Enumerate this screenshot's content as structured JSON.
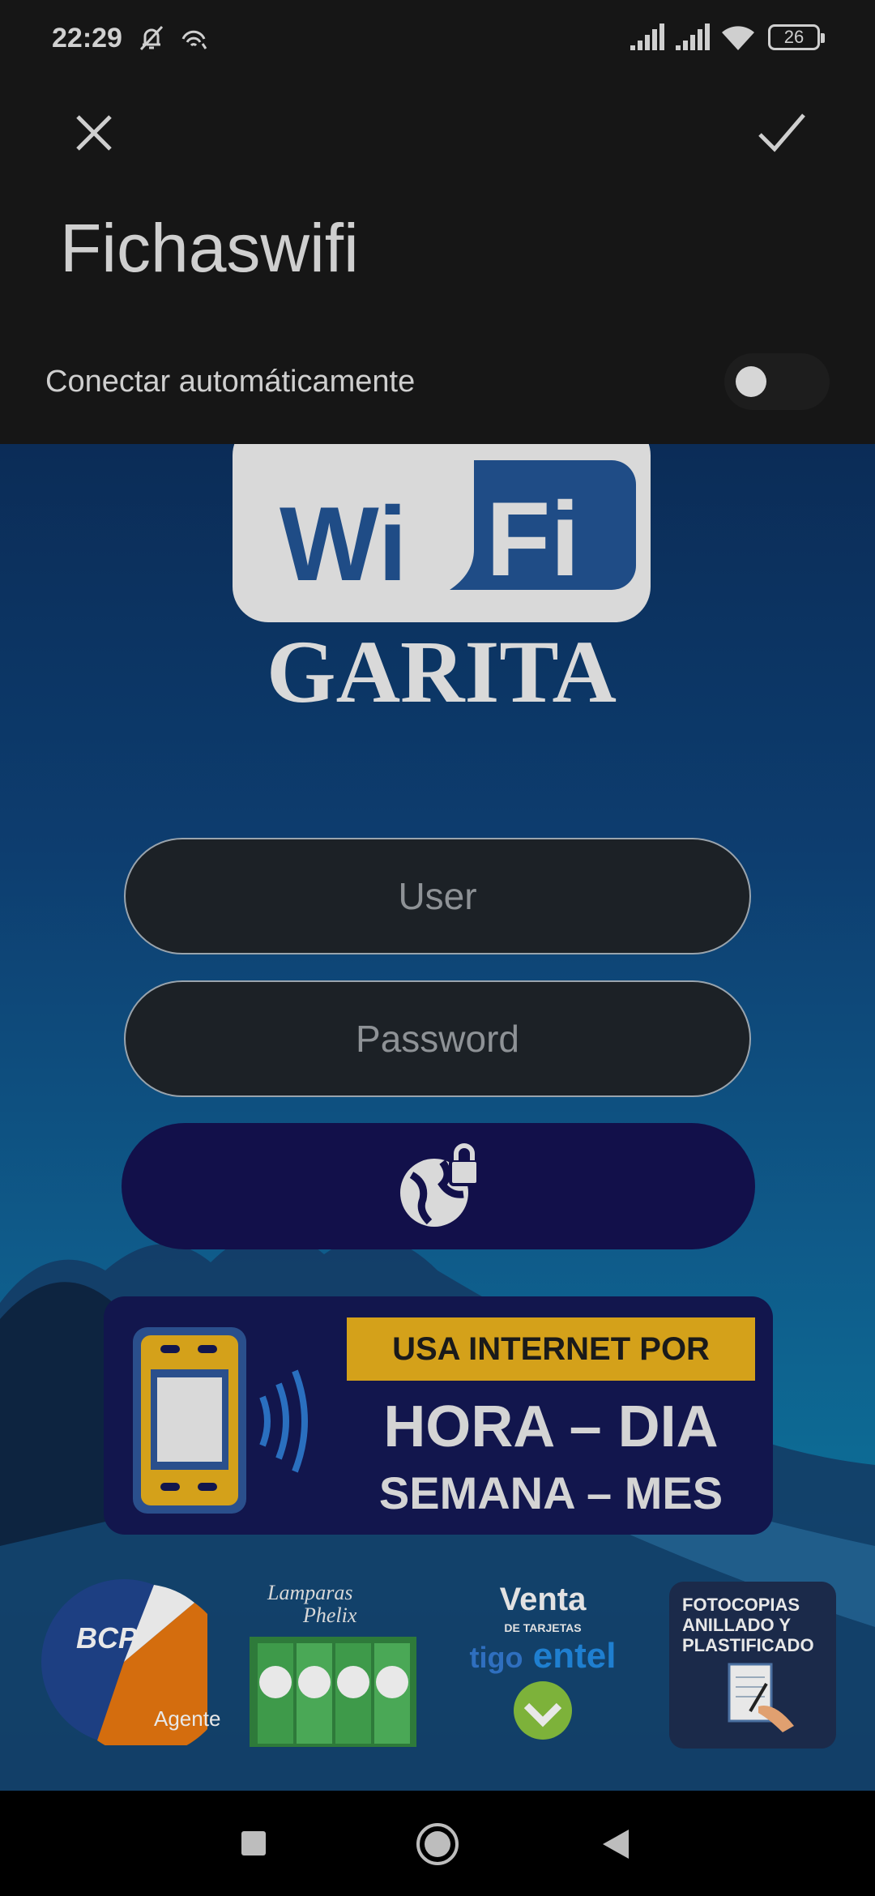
{
  "status_bar": {
    "time": "22:29",
    "battery": "26",
    "icons": [
      "muted-bell-icon",
      "wifi-hotspot-icon",
      "signal-icon",
      "signal-icon",
      "wifi-icon",
      "battery-icon"
    ]
  },
  "dialog": {
    "network_name": "Fichaswifi",
    "auto_connect_label": "Conectar automáticamente",
    "auto_connect_on": false,
    "close_icon": "close-icon",
    "confirm_icon": "check-icon"
  },
  "portal": {
    "logo_text_top": "Wi",
    "logo_text_fi": "Fi",
    "logo_text_bottom": "GARITA",
    "user_placeholder": "User",
    "password_placeholder": "Password",
    "login_icon": "globe-lock-icon",
    "banner": {
      "line1": "USA INTERNET POR",
      "line2": "HORA – DIA",
      "line3": "SEMANA – MES"
    },
    "ads": {
      "bcp_name": "BCP",
      "bcp_sub": "Agente",
      "lamp_title_1": "Lamparas",
      "lamp_title_2": "Phelix",
      "venta_title": "Venta",
      "venta_sub": "DE TARJETAS",
      "venta_brand_1": "tigo",
      "venta_brand_2": "entel",
      "foto_lines": [
        "FOTOCOPIAS",
        "ANILLADO Y",
        "PLASTIFICADO"
      ]
    }
  },
  "colors": {
    "header_bg": "#161616",
    "login_button": "#12104a",
    "banner_bg": "#12164d",
    "banner_accent": "#d4a11a"
  },
  "nav": {
    "icons": [
      "square-recents-icon",
      "circle-home-icon",
      "triangle-back-icon"
    ]
  }
}
